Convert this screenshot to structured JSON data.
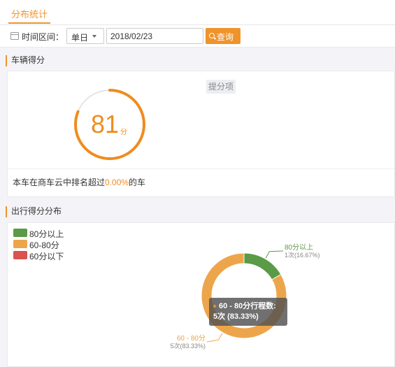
{
  "tabs": [
    {
      "label": "分布统计"
    }
  ],
  "filter": {
    "label": "时间区间：",
    "period_value": "单日",
    "date_value": "2018/02/23",
    "query_label": "查询"
  },
  "vehicle_score": {
    "section_title": "车辆得分",
    "score": "81",
    "unit": "分",
    "score_fraction": 0.81,
    "tag_label": "提分项",
    "rank_prefix": "本车在商车云中排名超过",
    "rank_value": "0.00%",
    "rank_suffix": "的车",
    "colors": {
      "accent": "#ef8c1f",
      "track": "#dddddd"
    }
  },
  "distribution": {
    "section_title": "出行得分分布",
    "legend": [
      {
        "label": "80分以上",
        "color": "#5b9a46"
      },
      {
        "label": "60-80分",
        "color": "#eda54b"
      },
      {
        "label": "60分以下",
        "color": "#d9534f"
      }
    ],
    "tooltip_line1": "60 - 80分行程数:",
    "tooltip_line2": "5次 (83.33%)"
  },
  "chart_data": {
    "type": "pie",
    "categories": [
      "80分以上",
      "60 - 80分"
    ],
    "values": [
      1,
      5
    ],
    "value_labels": [
      "1次(16.67%)",
      "5次(83.33%)"
    ],
    "colors": [
      "#5b9a46",
      "#eda54b"
    ]
  }
}
